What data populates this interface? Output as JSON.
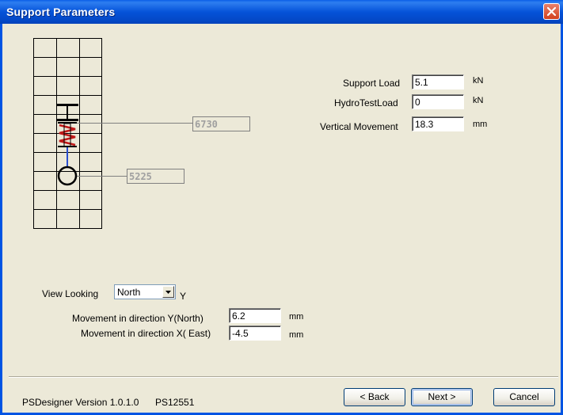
{
  "window": {
    "title": "Support Parameters"
  },
  "diagram": {
    "upper_tag": "6730",
    "lower_tag": "5225"
  },
  "params": {
    "support_load": {
      "label": "Support Load",
      "value": "5.1",
      "unit": "kN"
    },
    "hydrotest_load": {
      "label": "HydroTestLoad",
      "value": "0",
      "unit": "kN"
    },
    "vertical_movement": {
      "label": "Vertical Movement",
      "value": "18.3",
      "unit": "mm"
    }
  },
  "view": {
    "label": "View Looking",
    "selected": "North",
    "axis": "Y"
  },
  "movement": {
    "y": {
      "label": "Movement in direction Y(North)",
      "value": "6.2",
      "unit": "mm"
    },
    "x": {
      "label": "Movement in direction X( East)",
      "value": "-4.5",
      "unit": "mm"
    }
  },
  "footer": {
    "version": "PSDesigner Version 1.0.1.0",
    "code": "PS12551",
    "back": "< Back",
    "next": "Next >",
    "cancel": "Cancel"
  },
  "colors": {
    "titlebar": "#0553D9",
    "spring": "#C01818",
    "rod": "#2A4FD0",
    "dialog_bg": "#ECE9D8"
  }
}
